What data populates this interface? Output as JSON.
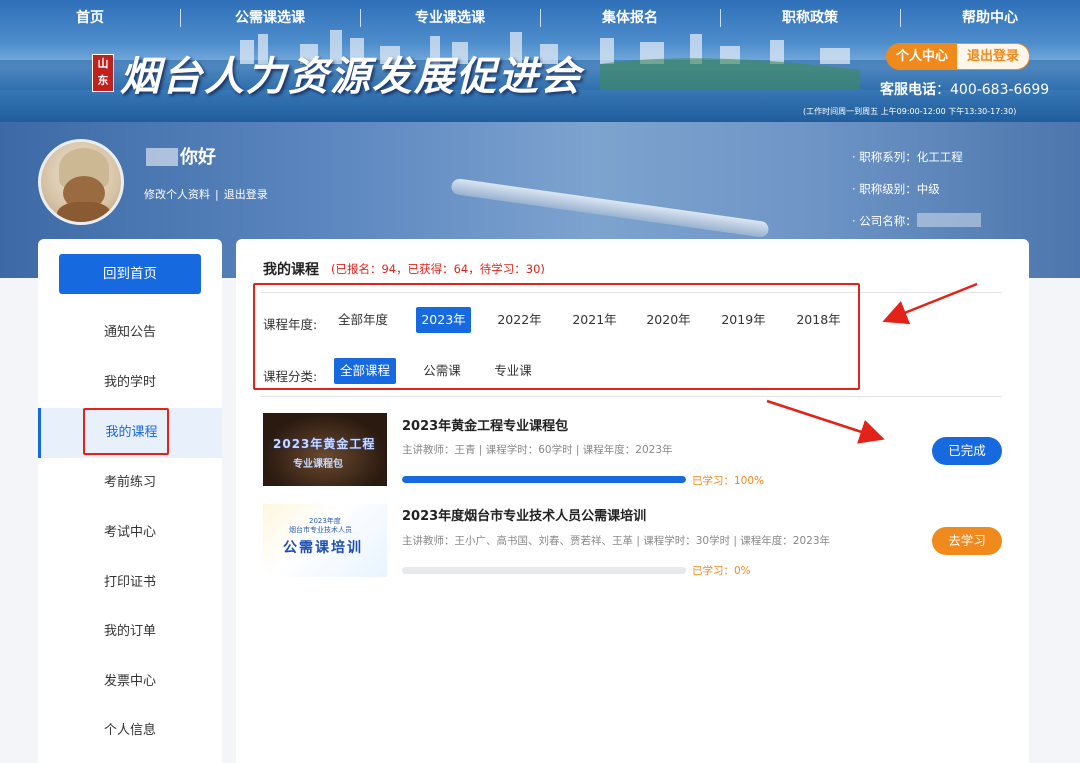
{
  "nav": [
    "首页",
    "公需课选课",
    "专业课选课",
    "集体报名",
    "职称政策",
    "帮助中心"
  ],
  "header": {
    "seal": "山东",
    "logo": "烟台人力资源发展促进会",
    "personal_center": "个人中心",
    "logout": "退出登录",
    "hotline_label": "客服电话",
    "hotline": "400-683-6699",
    "hours": "(工作时间周一到周五 上午09:00-12:00 下午13:30-17:30)"
  },
  "profile": {
    "greeting": "你好",
    "edit_profile": "修改个人资料",
    "separator": "|",
    "logout": "退出登录",
    "title_series": "· 职称系列：化工工程",
    "title_level": "· 职称级别：中级",
    "company": "· 公司名称："
  },
  "sidebar": {
    "home": "回到首页",
    "items": [
      "通知公告",
      "我的学时",
      "我的课程",
      "考前练习",
      "考试中心",
      "打印证书",
      "我的订单",
      "发票中心",
      "个人信息"
    ]
  },
  "main": {
    "title": "我的课程",
    "stats": "(已报名：94，已获得：64，待学习：30)",
    "year_label": "课程年度:",
    "years": [
      "全部年度",
      "2023年",
      "2022年",
      "2021年",
      "2020年",
      "2019年",
      "2018年"
    ],
    "selected_year": "2023年",
    "category_label": "课程分类:",
    "categories": [
      "全部课程",
      "公需课",
      "专业课"
    ],
    "selected_category": "全部课程"
  },
  "courses": [
    {
      "name": "2023年黄金工程专业课程包",
      "meta": "主讲教师：王青 | 课程学时：60学时 | 课程年度：2023年",
      "thumb_line1": "2023年黄金工程",
      "thumb_line2": "专业课程包",
      "progress": 1.0,
      "progress_text": "已学习：100%",
      "status": "已完成",
      "status_color": "#1769e0"
    },
    {
      "name": "2023年度烟台市专业技术人员公需课培训",
      "meta": "主讲教师：王小广、高书国、刘春、贾若祥、王革 | 课程学时：30学时 | 课程年度：2023年",
      "thumb_line1": "2023年度",
      "thumb_line2": "烟台市专业技术人员",
      "thumb_line3": "公需课培训",
      "progress": 0.0,
      "progress_text": "已学习：0%",
      "status": "去学习",
      "status_color": "#f08a1c"
    }
  ],
  "colors": {
    "accent": "#1769e0",
    "orange": "#f08a1c",
    "highlight_red": "#e2231a"
  }
}
